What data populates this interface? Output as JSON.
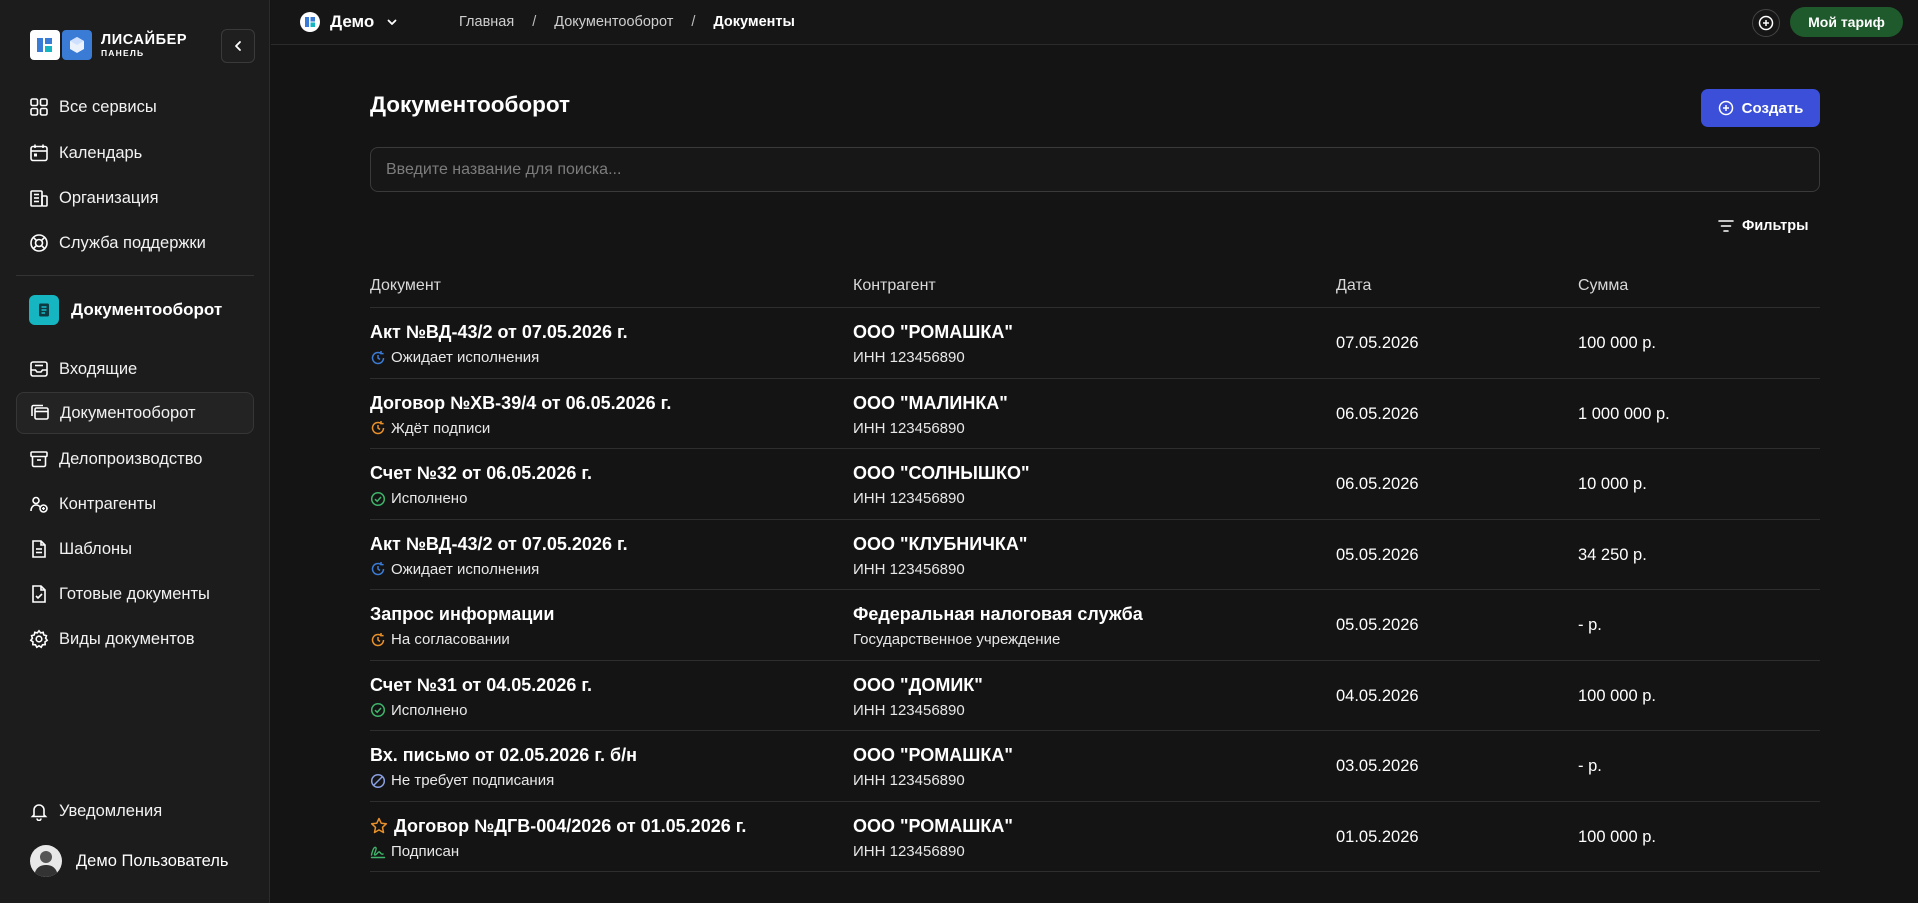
{
  "sidebar": {
    "logo_title": "ЛИСАЙБЕР",
    "logo_subtitle": "ПАНЕЛЬ",
    "nav_top": [
      {
        "label": "Все сервисы",
        "icon": "grid-icon"
      },
      {
        "label": "Календарь",
        "icon": "calendar-icon"
      },
      {
        "label": "Организация",
        "icon": "building-icon"
      },
      {
        "label": "Служба поддержки",
        "icon": "lifebuoy-icon"
      }
    ],
    "section_title": "Документооборот",
    "nav_section": [
      {
        "label": "Входящие",
        "icon": "inbox-icon"
      },
      {
        "label": "Документооборот",
        "icon": "folders-icon",
        "active": true
      },
      {
        "label": "Делопроизводство",
        "icon": "archive-icon"
      },
      {
        "label": "Контрагенты",
        "icon": "users-icon"
      },
      {
        "label": "Шаблоны",
        "icon": "template-icon"
      },
      {
        "label": "Готовые документы",
        "icon": "document-check-icon"
      },
      {
        "label": "Виды документов",
        "icon": "gear-icon"
      }
    ],
    "notifications_label": "Уведомления",
    "user_name": "Демо Пользователь"
  },
  "topbar": {
    "workspace": "Демо",
    "breadcrumb": [
      "Главная",
      "Документооборот",
      "Документы"
    ],
    "tariff_label": "Мой тариф"
  },
  "main": {
    "title": "Документооборот",
    "create_label": "Создать",
    "search_placeholder": "Введите название для поиска...",
    "filters_label": "Фильтры",
    "columns": [
      "Документ",
      "Контрагент",
      "Дата",
      "Сумма"
    ],
    "rows": [
      {
        "title": "Акт №ВД-43/2 от 07.05.2026 г.",
        "status": "Ожидает исполнения",
        "status_icon": "clock-arrow-icon",
        "status_color": "#3a7bd5",
        "party": "ООО \"РОМАШКА\"",
        "party_sub": "ИНН 123456890",
        "date": "07.05.2026",
        "sum": "100 000 р."
      },
      {
        "title": "Договор №ХВ-39/4 от 06.05.2026 г.",
        "status": "Ждёт подписи",
        "status_icon": "clock-arrow-icon",
        "status_color": "#e8902a",
        "party": "ООО \"МАЛИНКА\"",
        "party_sub": "ИНН 123456890",
        "date": "06.05.2026",
        "sum": "1 000 000 р."
      },
      {
        "title": "Счет №32 от 06.05.2026 г.",
        "status": "Исполнено",
        "status_icon": "check-circle-icon",
        "status_color": "#3fb46a",
        "party": "ООО \"СОЛНЫШКО\"",
        "party_sub": "ИНН 123456890",
        "date": "06.05.2026",
        "sum": "10 000 р."
      },
      {
        "title": "Акт №ВД-43/2 от 07.05.2026 г.",
        "status": "Ожидает исполнения",
        "status_icon": "clock-arrow-icon",
        "status_color": "#3a7bd5",
        "party": "ООО \"КЛУБНИЧКА\"",
        "party_sub": "ИНН 123456890",
        "date": "05.05.2026",
        "sum": "34 250 р."
      },
      {
        "title": "Запрос информации",
        "status": "На согласовании",
        "status_icon": "clock-arrow-icon",
        "status_color": "#e8902a",
        "party": "Федеральная налоговая служба",
        "party_sub": "Государственное учреждение",
        "date": "05.05.2026",
        "sum": "- р."
      },
      {
        "title": "Счет №31 от 04.05.2026 г.",
        "status": "Исполнено",
        "status_icon": "check-circle-icon",
        "status_color": "#3fb46a",
        "party": "ООО \"ДОМИК\"",
        "party_sub": "ИНН 123456890",
        "date": "04.05.2026",
        "sum": "100 000 р."
      },
      {
        "title": "Вх. письмо от 02.05.2026 г. б/н",
        "status": "Не требует подписания",
        "status_icon": "slash-circle-icon",
        "status_color": "#8aa0e0",
        "party": "ООО \"РОМАШКА\"",
        "party_sub": "ИНН 123456890",
        "date": "03.05.2026",
        "sum": "- р."
      },
      {
        "title": "Договор №ДГВ-004/2026 от 01.05.2026 г.",
        "starred": true,
        "status": "Подписан",
        "status_icon": "signature-icon",
        "status_color": "#3fb46a",
        "party": "ООО \"РОМАШКА\"",
        "party_sub": "ИНН 123456890",
        "date": "01.05.2026",
        "sum": "100 000 р."
      }
    ]
  }
}
